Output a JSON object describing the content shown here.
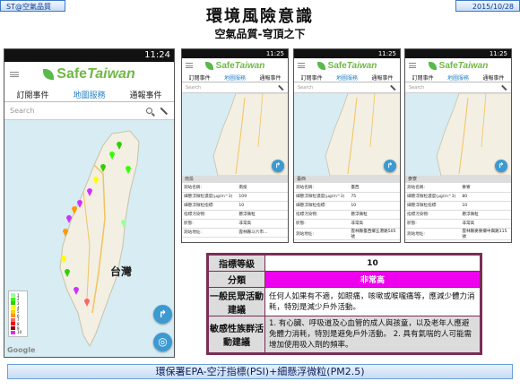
{
  "header": {
    "tag_left": "ST@空氣品質",
    "tag_right": "2015/10/28",
    "title": "環境風險意識",
    "subtitle": "空氣品質-穹頂之下"
  },
  "app": {
    "brand_safe": "Safe",
    "brand_taiwan": "Taiwan",
    "status_time_large": "11:24",
    "status_time_small": "11:25",
    "tabs": [
      "訂閱事件",
      "地圖服務",
      "通報事件"
    ],
    "active_tab": 1,
    "search_placeholder": "Search",
    "map_label_taiwan": "台灣",
    "google": "Google"
  },
  "legend": [
    {
      "label": "1",
      "color": "#9cff9c"
    },
    {
      "label": "2",
      "color": "#31ff00"
    },
    {
      "label": "3",
      "color": "#31cf00"
    },
    {
      "label": "4",
      "color": "#ffff00"
    },
    {
      "label": "5",
      "color": "#ffcf00"
    },
    {
      "label": "6",
      "color": "#ff9a00"
    },
    {
      "label": "7",
      "color": "#ff6464"
    },
    {
      "label": "8",
      "color": "#ff0000"
    },
    {
      "label": "9",
      "color": "#990000"
    },
    {
      "label": "10",
      "color": "#ce30ff"
    }
  ],
  "stations": [
    {
      "region": "南投",
      "fields": [
        {
          "k": "測站名稱:",
          "v": "南投"
        },
        {
          "k": "細懸浮微粒濃度(μg/m^3)",
          "v": "109"
        },
        {
          "k": "細懸浮微粒指標:",
          "v": "10"
        },
        {
          "k": "指標污染物:",
          "v": "懸浮微粒"
        },
        {
          "k": "狀態:",
          "v": "非常高"
        },
        {
          "k": "測站地址:",
          "v": "雲林縣斗六市..."
        }
      ]
    },
    {
      "region": "臺西",
      "fields": [
        {
          "k": "測站名稱:",
          "v": "臺西"
        },
        {
          "k": "細懸浮微粒濃度(μg/m^3)",
          "v": "75"
        },
        {
          "k": "細懸浮微粒指標:",
          "v": "10"
        },
        {
          "k": "指標污染物:",
          "v": "懸浮微粒"
        },
        {
          "k": "狀態:",
          "v": "非常高"
        },
        {
          "k": "測站地址:",
          "v": "雲林縣臺西鄉五港路505號"
        }
      ]
    },
    {
      "region": "麥寮",
      "fields": [
        {
          "k": "測站名稱:",
          "v": "麥寮"
        },
        {
          "k": "細懸浮微粒濃度(μg/m^3)",
          "v": "80"
        },
        {
          "k": "細懸浮微粒指標:",
          "v": "10"
        },
        {
          "k": "指標污染物:",
          "v": "懸浮微粒"
        },
        {
          "k": "狀態:",
          "v": "非常高"
        },
        {
          "k": "測站地址:",
          "v": "雲林縣麥寮鄉中興路115號"
        }
      ]
    }
  ],
  "psi_table": {
    "rows": [
      {
        "label": "指標等級",
        "value": "10"
      },
      {
        "label": "分類",
        "value": "非常高"
      },
      {
        "label": "一般民眾活動建議",
        "value": "任何人如果有不適，如眼痛，咳嗽或喉嚨痛等，應減少體力消耗，特別是減少戶外活動。"
      },
      {
        "label": "敏感性族群活動建議",
        "value": "1. 有心臟、呼吸道及心血管的成人與孩童，以及老年人應避免體力消耗，特別是避免戶外活動。 2. 具有氣喘的人可能需增加使用吸入劑的頻率。"
      }
    ]
  },
  "footer": "環保署EPA-空汙指標(PSI)+細懸浮微粒(PM2.5)"
}
